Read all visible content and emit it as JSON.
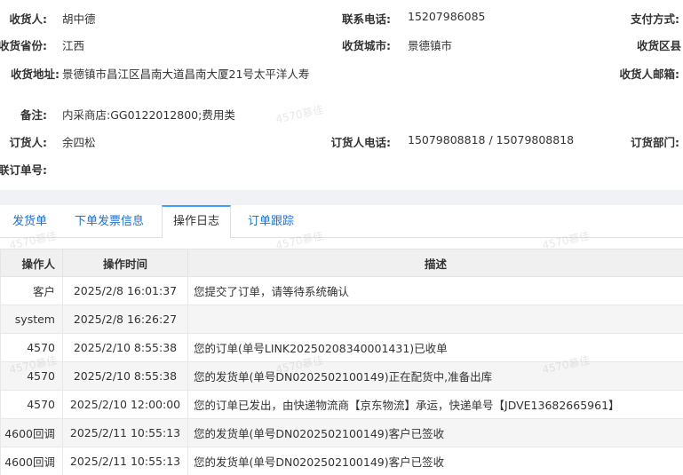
{
  "order_info": {
    "row1": {
      "receiver_label": "收货人:",
      "receiver": "胡中德",
      "phone_label": "联系电话:",
      "phone": "15207986085",
      "payment_label": "支付方式:"
    },
    "row2": {
      "province_label": "收货省份:",
      "province": "江西",
      "city_label": "收货城市:",
      "city": "景德镇市",
      "district_label": "收货区县"
    },
    "row3": {
      "address_label": "收货地址:",
      "address": "景德镇市昌江区昌南大道昌南大厦21号太平洋人寿",
      "email_label": "收货人邮箱:"
    },
    "row4": {
      "remark_label": "备注:",
      "remark": "内采商店:GG0122012800;费用类"
    },
    "row5": {
      "orderer_label": "订货人:",
      "orderer": "余四松",
      "orderer_phone_label": "订货人电话:",
      "orderer_phone": "15079808818 / 15079808818",
      "dept_label": "订货部门:"
    },
    "row6": {
      "ref_label": "联订单号:"
    }
  },
  "tabs": [
    {
      "label": "发货单"
    },
    {
      "label": "下单发票信息"
    },
    {
      "label": "操作日志"
    },
    {
      "label": "订单跟踪"
    }
  ],
  "active_tab": "操作日志",
  "log_table": {
    "headers": [
      "操作人",
      "操作时间",
      "描述"
    ],
    "rows": [
      [
        "客户",
        "2025/2/8 16:01:37",
        "您提交了订单，请等待系统确认"
      ],
      [
        "system",
        "2025/2/8 16:26:27",
        ""
      ],
      [
        "4570",
        "2025/2/10 8:55:38",
        "您的订单(单号LINK20250208340001431)已收单"
      ],
      [
        "4570",
        "2025/2/10 8:55:38",
        "您的发货单(单号DN0202502100149)正在配货中,准备出库"
      ],
      [
        "4570",
        "2025/2/10 12:00:00",
        "您的订单已发出，由快递物流商【京东物流】承运，快递单号【JDVE13682665961】"
      ],
      [
        "4600回调",
        "2025/2/11 10:55:13",
        "您的发货单(单号DN0202502100149)客户已签收"
      ],
      [
        "4600回调",
        "2025/2/11 10:55:13",
        "您的发货单(单号DN0202502100149)客户已签收"
      ]
    ]
  },
  "watermark": "4570慕佳"
}
